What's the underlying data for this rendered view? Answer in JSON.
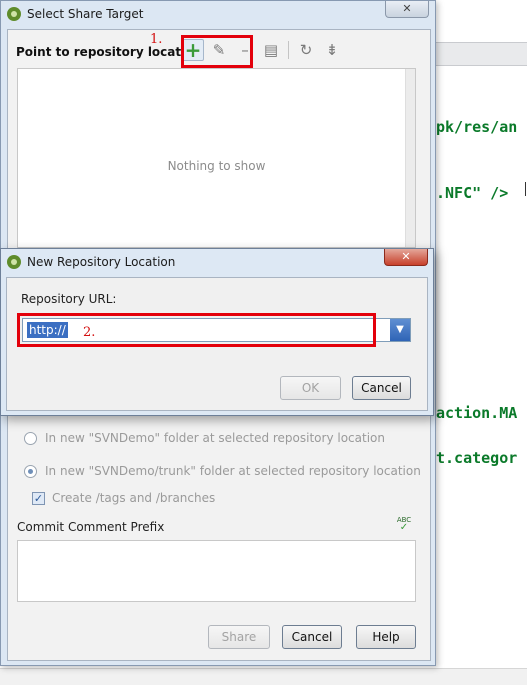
{
  "editor": {
    "lines": [
      {
        "text": "pk/res/an",
        "class": "green"
      },
      {
        "text": ".NFC\" />",
        "class": "code"
      },
      {
        "text": "action.MA",
        "class": "green"
      },
      {
        "text": "t.categor",
        "class": "green"
      }
    ]
  },
  "share_dialog": {
    "title": "Select Share Target",
    "close_icon": "✕",
    "section_label": "Point to repository location",
    "toolbar": {
      "add_icon": "+",
      "edit_icon": "✎",
      "remove_icon": "–",
      "details_icon": "▤",
      "refresh_icon": "↻",
      "collapse_icon": "⇟"
    },
    "empty_list_text": "Nothing to show",
    "options": {
      "in_folder": "In new \"SVNDemo\" folder at selected repository location",
      "in_trunk": "In new \"SVNDemo/trunk\" folder at selected repository location",
      "create_tags": "Create /tags and /branches",
      "create_tags_checked": true
    },
    "commit_prefix_label": "Commit Comment Prefix",
    "spell_icon_label": "ABC",
    "buttons": {
      "share": "Share",
      "cancel": "Cancel",
      "help": "Help"
    }
  },
  "repo_dialog": {
    "title": "New Repository Location",
    "close_icon": "✕",
    "url_label": "Repository URL:",
    "url_value": "http://",
    "buttons": {
      "ok": "OK",
      "cancel": "Cancel"
    }
  },
  "annotations": {
    "step1": "1.",
    "step2": "2."
  },
  "colors": {
    "annotation_red": "#e3000b",
    "title_bar": "#dce7f3",
    "selection": "#3b6fc2"
  }
}
